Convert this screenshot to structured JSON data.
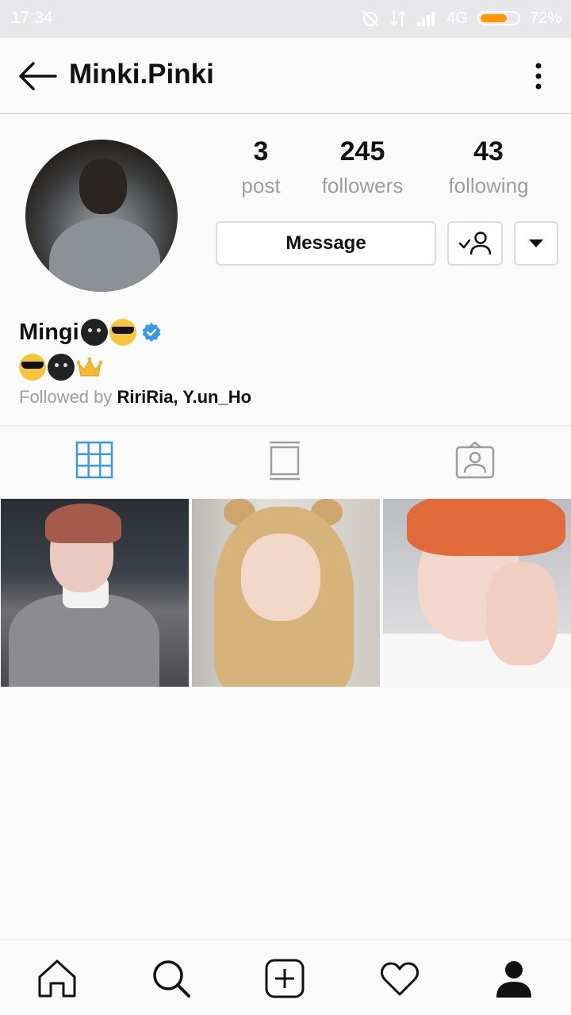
{
  "status_bar": {
    "time": "17:34",
    "network": "4G",
    "battery": "72%",
    "battery_level": 0.72
  },
  "header": {
    "title": "Minki.Pinki",
    "back_icon": "arrow-left-icon",
    "menu_icon": "more-vertical-icon"
  },
  "profile": {
    "stats": [
      {
        "value": "3",
        "label": "post"
      },
      {
        "value": "245",
        "label": "followers"
      },
      {
        "value": "43",
        "label": "following"
      }
    ],
    "message_label": "Message",
    "name": "Mingi",
    "followed_by_prefix": "Followed by ",
    "followed_by_names": "RiriRia, Y.un_Ho"
  },
  "tabs": [
    {
      "name": "grid",
      "icon": "grid-icon",
      "active": true
    },
    {
      "name": "feed",
      "icon": "feed-icon",
      "active": false
    },
    {
      "name": "tagged",
      "icon": "tagged-icon",
      "active": false
    }
  ],
  "colors": {
    "accent": "#3897f0",
    "battery": "#ff9800",
    "muted_text": "#9e9e9e"
  },
  "bottom_nav": [
    "home-icon",
    "search-icon",
    "add-post-icon",
    "heart-icon",
    "profile-icon"
  ]
}
